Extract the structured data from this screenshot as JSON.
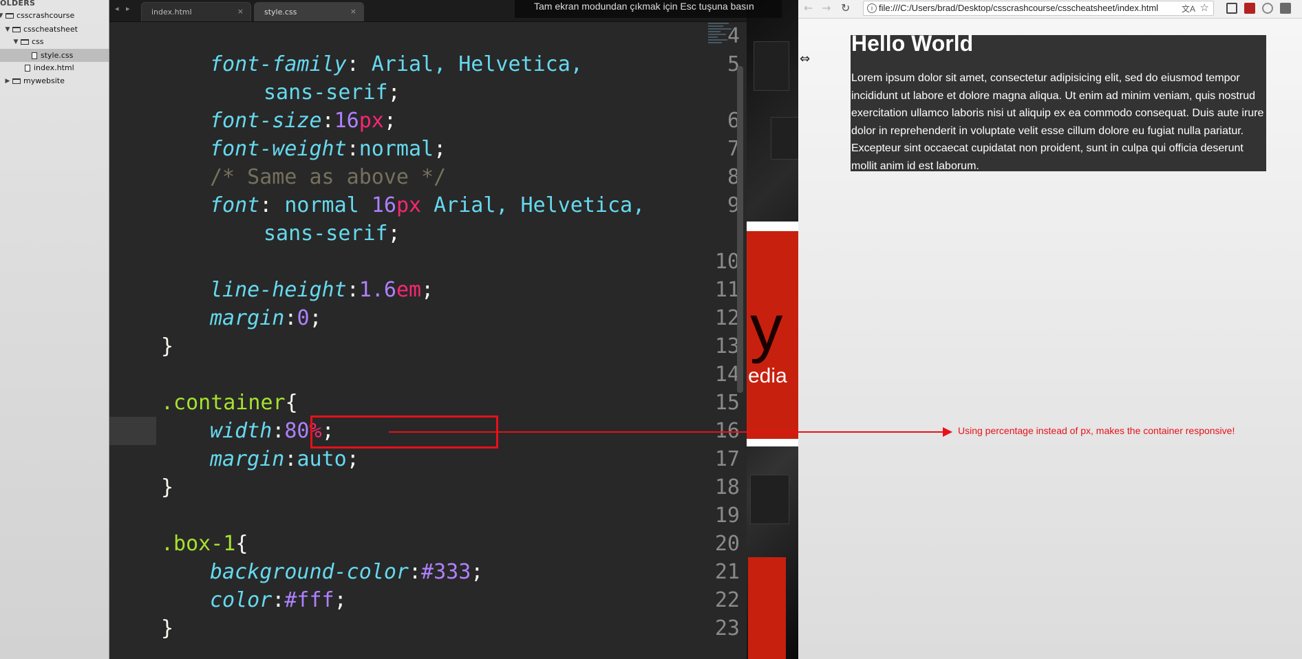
{
  "sidebar": {
    "header": "OLDERS",
    "items": [
      {
        "label": "csscrashcourse",
        "arrow": "▼"
      },
      {
        "label": "csscheatsheet",
        "arrow": "▼"
      },
      {
        "label": "css",
        "arrow": "▼"
      },
      {
        "label": "style.css"
      },
      {
        "label": "index.html"
      },
      {
        "label": "mywebsite",
        "arrow": "▶"
      }
    ]
  },
  "editor": {
    "nav_back": "◂",
    "nav_forward": "▸",
    "tabs": [
      {
        "label": "index.html",
        "close": "×"
      },
      {
        "label": "style.css",
        "close": "×"
      }
    ],
    "line_numbers": [
      "4",
      "5",
      "6",
      "7",
      "8",
      "9",
      "10",
      "11",
      "12",
      "13",
      "14",
      "15",
      "16",
      "17",
      "18",
      "19",
      "20",
      "21",
      "22",
      "23"
    ],
    "code": {
      "l5_prop": "font-family",
      "l5_colon": ":",
      "l5_val": " Arial, Helvetica,",
      "l5b_val": "sans-serif",
      "l5b_end": ";",
      "l6_prop": "font-size",
      "l6_colon": ":",
      "l6_num": "16",
      "l6_unit": "px",
      "l6_end": ";",
      "l7_prop": "font-weight",
      "l7_colon": ":",
      "l7_val": "normal",
      "l7_end": ";",
      "l8_comment": "/* Same as above */",
      "l9_prop": "font",
      "l9_colon": ":",
      "l9_val1": " normal ",
      "l9_num": "16",
      "l9_unit": "px",
      "l9_val2": " Arial, Helvetica,",
      "l9b_val": "sans-serif",
      "l9b_end": ";",
      "l11_prop": "line-height",
      "l11_colon": ":",
      "l11_num": "1.6",
      "l11_unit": "em",
      "l11_end": ";",
      "l12_prop": "margin",
      "l12_colon": ":",
      "l12_num": "0",
      "l12_end": ";",
      "l13_brace": "}",
      "l15_sel": ".container",
      "l15_brace": "{",
      "l16_prop": "width",
      "l16_colon": ":",
      "l16_num": "80",
      "l16_unit": "%",
      "l16_end": ";",
      "l17_prop": "margin",
      "l17_colon": ":",
      "l17_val": "auto",
      "l17_end": ";",
      "l18_brace": "}",
      "l20_sel": ".box-1",
      "l20_brace": "{",
      "l21_prop": "background-color",
      "l21_colon": ":",
      "l21_val": "#333",
      "l21_end": ";",
      "l22_prop": "color",
      "l22_colon": ":",
      "l22_val": "#fff",
      "l22_end": ";",
      "l23_brace": "}"
    }
  },
  "overlay": {
    "fullscreen_notice": "Tam ekran modundan çıkmak için Esc tuşuna basın",
    "wall_letter": "y M",
    "wall_sub": "edia"
  },
  "browser": {
    "back": "←",
    "forward": "→",
    "reload": "↻",
    "info_icon": "i",
    "url": "file:///C:/Users/brad/Desktop/csscrashcourse/csscheatsheet/index.html",
    "translate_icon": "文A",
    "star_icon": "☆",
    "page": {
      "heading": "Hello World",
      "paragraph": "Lorem ipsum dolor sit amet, consectetur adipisicing elit, sed do eiusmod tempor incididunt ut labore et dolore magna aliqua. Ut enim ad minim veniam, quis nostrud exercitation ullamco laboris nisi ut aliquip ex ea commodo consequat. Duis aute irure dolor in reprehenderit in voluptate velit esse cillum dolore eu fugiat nulla pariatur. Excepteur sint occaecat cupidatat non proident, sunt in culpa qui officia deserunt mollit anim id est laborum."
    },
    "resize_cursor": "⇔"
  },
  "annotation": {
    "text": "Using percentage instead of px, makes the container responsive!",
    "color": "#e8101a"
  },
  "theme": {
    "editor_bg": "#282828",
    "property_color": "#66d9ef",
    "number_color": "#ae81ff",
    "unit_color": "#f92672",
    "selector_color": "#a6e22e",
    "comment_color": "#75715e",
    "box_bg": "#333333"
  }
}
